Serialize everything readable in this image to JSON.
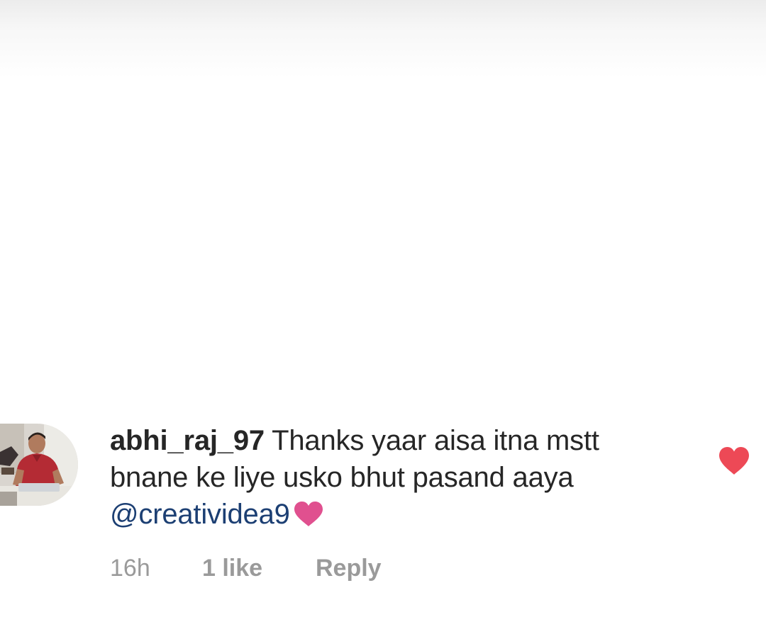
{
  "comment": {
    "username": "abhi_raj_97",
    "text_line1": "Thanks yaar aisa itna mstt",
    "text_line2": "bnane ke liye usko bhut pasand aaya",
    "mention": "@creatividea9",
    "inline_emoji_icon": "pink-heart-icon",
    "timestamp": "16h",
    "likes_label": "1 like",
    "reply_label": "Reply",
    "liked": true,
    "like_icon": "heart-icon"
  },
  "colors": {
    "text": "#262626",
    "mention": "#1c3f73",
    "meta": "#9a9a9a",
    "like_heart": "#ed4956",
    "inline_heart": "#e0508f"
  }
}
